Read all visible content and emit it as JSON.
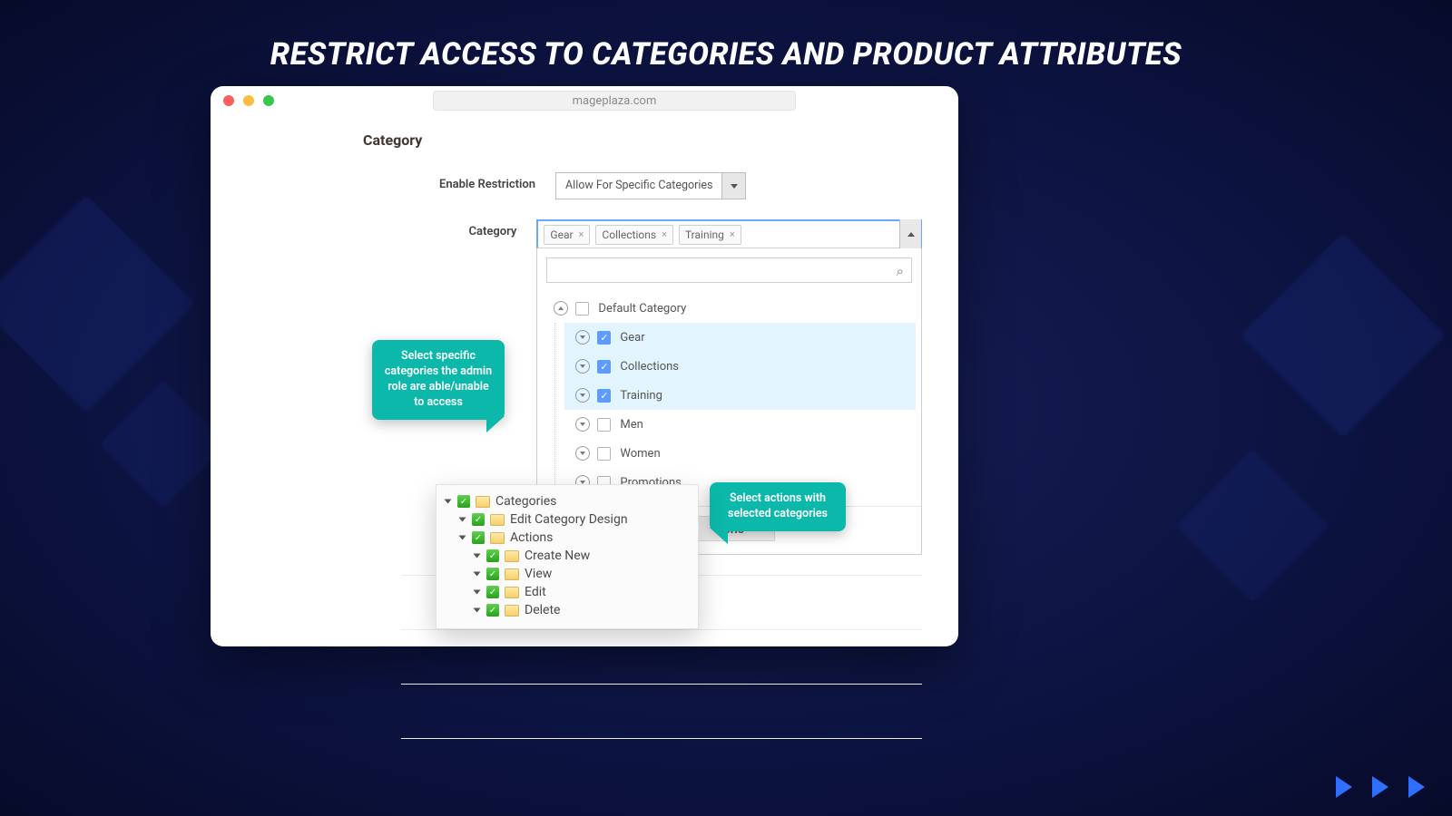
{
  "heading": "RESTRICT ACCESS TO CATEGORIES AND PRODUCT ATTRIBUTES",
  "url": "mageplaza.com",
  "section_title": "Category",
  "enable": {
    "label": "Enable Restriction",
    "value": "Allow For Specific Categories"
  },
  "category": {
    "label": "Category",
    "tags": [
      "Gear",
      "Collections",
      "Training"
    ],
    "root": "Default Category",
    "items": [
      {
        "label": "Gear",
        "checked": true
      },
      {
        "label": "Collections",
        "checked": true
      },
      {
        "label": "Training",
        "checked": true
      },
      {
        "label": "Men",
        "checked": false
      },
      {
        "label": "Women",
        "checked": false
      },
      {
        "label": "Promotions",
        "checked": false
      }
    ],
    "done": "Done"
  },
  "callouts": {
    "left": "Select specific categories the admin role are able/unable to access",
    "right": "Select actions with selected categories"
  },
  "permissions": {
    "root": "Categories",
    "design": "Edit Category Design",
    "actions_label": "Actions",
    "actions": [
      "Create New",
      "View",
      "Edit",
      "Delete"
    ]
  }
}
